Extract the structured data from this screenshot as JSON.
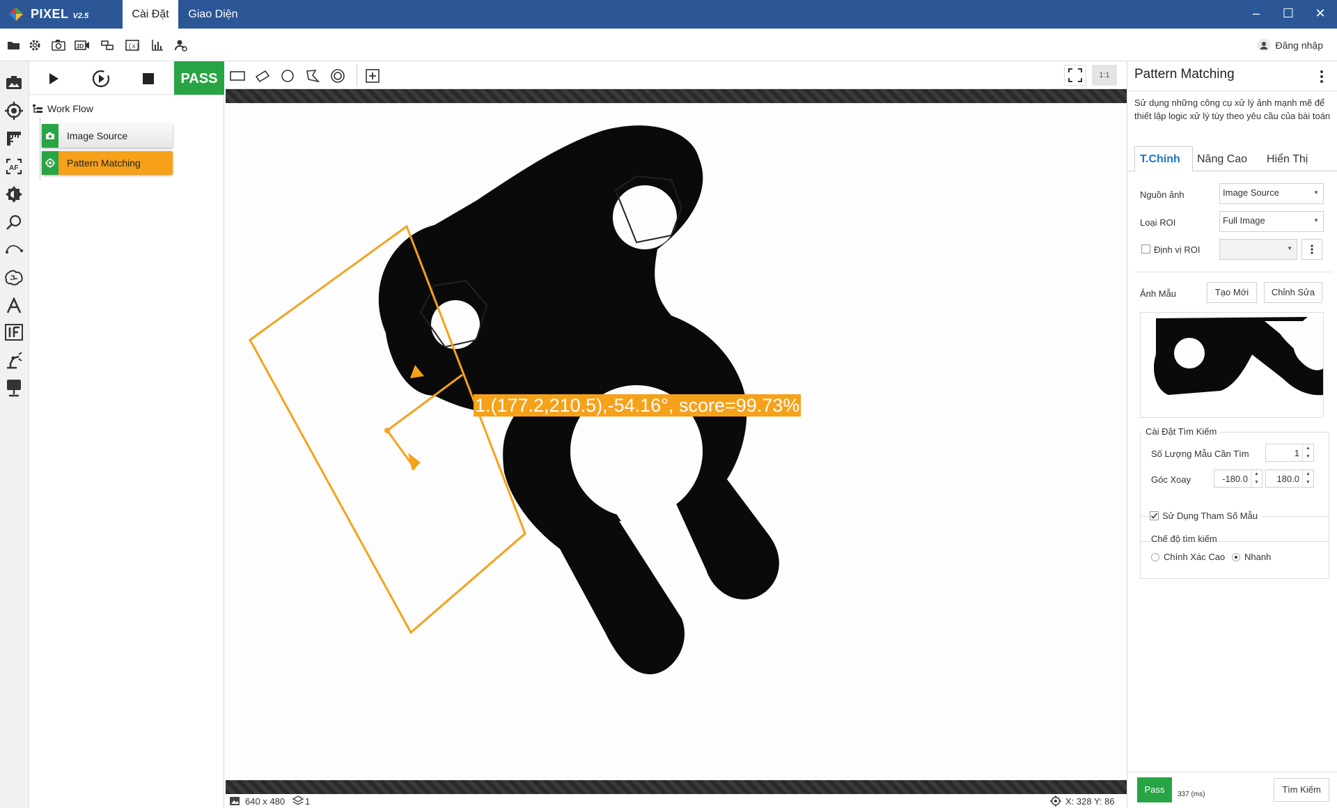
{
  "app": {
    "name": "PIXEL",
    "version": "V2.5"
  },
  "menu_tabs": [
    {
      "label": "Cài Đặt"
    },
    {
      "label": "Giao Diện"
    }
  ],
  "window": {
    "minimize": "–",
    "maximize": "☐",
    "close": "✕"
  },
  "toolbar": {
    "icons": [
      "folder-icon",
      "settings-icon",
      "camera-settings-icon",
      "video-3d-icon",
      "link-icon",
      "variable-icon",
      "chart-icon",
      "user-settings-icon"
    ],
    "login_label": "Đăng nhập"
  },
  "run_controls": {
    "status": "PASS"
  },
  "roi_tools": [
    "rectangle-roi-icon",
    "rotated-rectangle-roi-icon",
    "circle-roi-icon",
    "polygon-roi-icon",
    "ring-roi-icon",
    "add-roi-icon"
  ],
  "view_controls": {
    "zoom_label": "1:1"
  },
  "workflow": {
    "title": "Work Flow",
    "nodes": [
      {
        "label": "Image Source",
        "active": false
      },
      {
        "label": "Pattern Matching",
        "active": true
      }
    ]
  },
  "canvas": {
    "result_label": "1.(177.2,210.5),-54.16°, score=99.73%",
    "accent_color": "#f6a11a"
  },
  "status_bar": {
    "image_size": "640 x 480",
    "layers": "1",
    "coords": "X: 328 Y: 86"
  },
  "right_panel": {
    "title": "Pattern Matching",
    "description": "Sử dụng những công cụ xử lý ảnh mạnh mẽ để thiết lập logic xử lý tùy theo yêu cầu của bài toán",
    "tabs": [
      {
        "label": "T.Chính",
        "active": true
      },
      {
        "label": "Nâng Cao",
        "active": false
      },
      {
        "label": "Hiển Thị",
        "active": false
      }
    ],
    "image_source_label": "Nguồn ảnh",
    "image_source_value": "Image Source",
    "roi_type_label": "Loại ROI",
    "roi_type_value": "Full Image",
    "roi_locate_label": "Định vị ROI",
    "template_label": "Ảnh Mẫu",
    "create_new": "Tạo Mới",
    "edit": "Chỉnh Sửa",
    "search_group": "Cài Đặt Tìm Kiếm",
    "count_label": "Số Lượng Mẫu Cần Tìm",
    "count_value": "1",
    "angle_label": "Góc Xoay",
    "angle_min": "-180.0",
    "angle_max": "180.0",
    "use_params_label": "Sử Dụng Tham Số Mẫu",
    "mode_label": "Chế độ tìm kiếm",
    "mode_options": [
      {
        "label": "Chính Xác Cao",
        "selected": false
      },
      {
        "label": "Nhanh",
        "selected": true
      }
    ],
    "pass_label": "Pass",
    "time_value": "337",
    "time_unit": "(ms)",
    "search_button": "Tìm Kiếm"
  },
  "colors": {
    "titlebar": "#2c5797",
    "pass": "#27a544",
    "node_active": "#f6a11a",
    "tab_active": "#1a74c9"
  }
}
